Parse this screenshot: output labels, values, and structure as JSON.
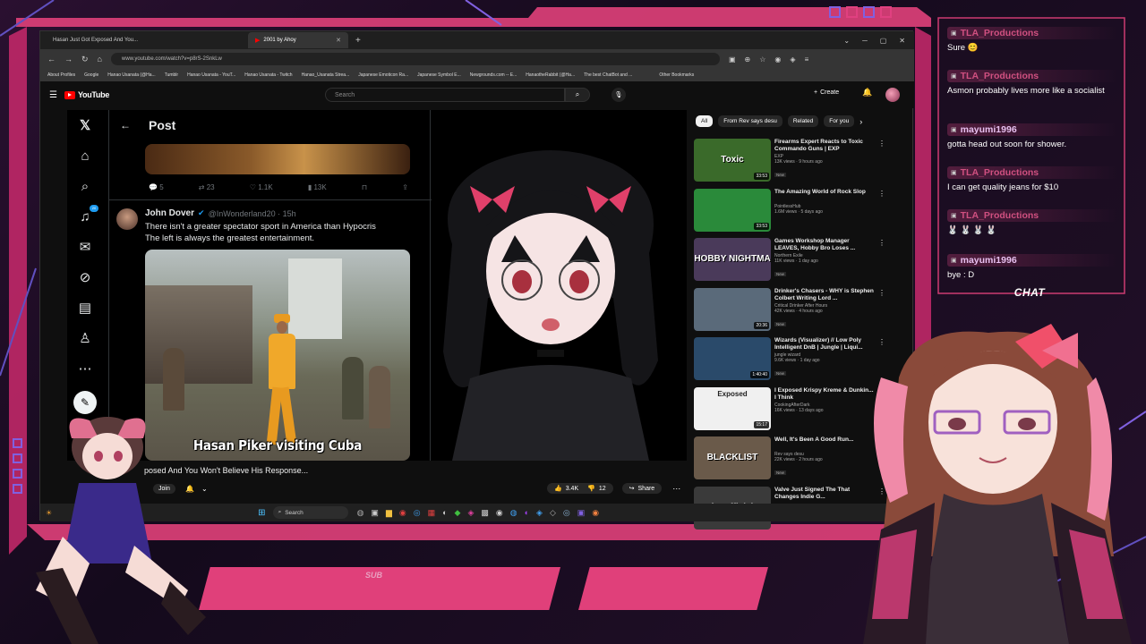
{
  "browser": {
    "tabs": [
      {
        "label": "Hasan Just Got Exposed And You..."
      },
      {
        "label": "2001 by Ahoy"
      }
    ],
    "url": "www.youtube.com/watch?v=p8rS-2SnkLw",
    "bookmarks": [
      "About Profiles",
      "Google",
      "Hanao Usanata (@Ha...",
      "Tumblr",
      "Hanao Usanata - YouT...",
      "Hanao Usanata - Twitch",
      "Hanao_Usanata Strea...",
      "Japanese Emoticon Ra...",
      "Japanese Symbol E...",
      "Newgrounds.com -- E...",
      "HanaotheRabbit (@Ha...",
      "The best ChatBot and ...",
      "Other Bookmarks"
    ]
  },
  "youtube": {
    "logo": "YouTube",
    "search_placeholder": "Search",
    "create_label": "Create",
    "chips": [
      "All",
      "From Rev says desu",
      "Related",
      "For you"
    ],
    "video_title": "posed And You Won't Believe His Response...",
    "join_label": "Join",
    "likes": "3.4K",
    "dislikes": "12",
    "share_label": "Share"
  },
  "x_post": {
    "header": "Post",
    "top_actions": {
      "replies": "5",
      "reposts": "23",
      "likes": "1.1K",
      "views": "13K"
    },
    "author_name": "John Dover",
    "author_handle": "@InWonderland20 · 15h",
    "text_line1": "There isn't a greater spectator sport in America than Hypocris",
    "text_line2": "The left is always the greatest entertainment.",
    "media_caption": "Hasan Piker visiting Cuba",
    "notification_badge": "20"
  },
  "recommendations": [
    {
      "title": "Firearms Expert Reacts to Toxic Commando Guns | EXP",
      "channel": "EXP",
      "views": "13K views · 9 hours ago",
      "badge": "New",
      "duration": "33:53",
      "thumb_text": "Toxic",
      "thumb_color": "#3a6a2a"
    },
    {
      "title": "The Amazing World of Rock Slop",
      "channel": "PointlessHub",
      "views": "1.6M views · 5 days ago",
      "badge": "",
      "duration": "33:53",
      "thumb_text": "",
      "thumb_color": "#2a8a3a"
    },
    {
      "title": "Games Workshop Manager LEAVES, Hobby Bro Loses ...",
      "channel": "Northern Exile",
      "views": "11K views · 1 day ago",
      "badge": "New",
      "duration": "",
      "thumb_text": "HOBBY NIGHTMA",
      "thumb_color": "#4a3a5a"
    },
    {
      "title": "Drinker's Chasers - WHY is Stephen Colbert Writing Lord ...",
      "channel": "Critical Drinker After Hours",
      "views": "42K views · 4 hours ago",
      "badge": "New",
      "duration": "20:36",
      "thumb_text": "",
      "thumb_color": "#5a6a7a"
    },
    {
      "title": "Wizards (Visualizer) // Low Poly Intelligent DnB | Jungle | Liqui...",
      "channel": "jungle wizard",
      "views": "9.6K views · 1 day ago",
      "badge": "New",
      "duration": "1:40:40",
      "thumb_text": "",
      "thumb_color": "#2a4a6a"
    },
    {
      "title": "I Exposed Krispy Kreme & Dunkin... I Think",
      "channel": "CookingAfterDark",
      "views": "16K views · 13 days ago",
      "badge": "",
      "duration": "15:17",
      "thumb_text": "Exposed",
      "thumb_color": "#f0f0f0"
    },
    {
      "title": "Well, It's Been A Good Run...",
      "channel": "Rev says desu",
      "views": "22K views · 2 hours ago",
      "badge": "New",
      "duration": "",
      "thumb_text": "BLACKLIST",
      "thumb_color": "#6a5a4a"
    },
    {
      "title": "Valve Just Signed The That Changes Indie G...",
      "channel": "",
      "views": "",
      "badge": "",
      "duration": "",
      "thumb_text": "its official",
      "thumb_color": "#3a3a3a"
    }
  ],
  "taskbar": {
    "search_label": "Search"
  },
  "chat": {
    "title": "CHAT",
    "messages": [
      {
        "user": "TLA_Productions",
        "text": "Sure 😊",
        "kind": "tla"
      },
      {
        "user": "TLA_Productions",
        "text": "Asmon probably lives more like a socialist",
        "kind": "tla"
      },
      {
        "user": "mayumi1996",
        "text": "gotta head out soon for shower.",
        "kind": "may"
      },
      {
        "user": "TLA_Productions",
        "text": "I can get quality jeans for $10",
        "kind": "tla"
      },
      {
        "user": "TLA_Productions",
        "text": "🐰 🐰 🐰 🐰",
        "kind": "tla"
      },
      {
        "user": "mayumi1996",
        "text": "bye : D",
        "kind": "may"
      }
    ]
  },
  "overlay": {
    "sub_label": "SUB"
  }
}
